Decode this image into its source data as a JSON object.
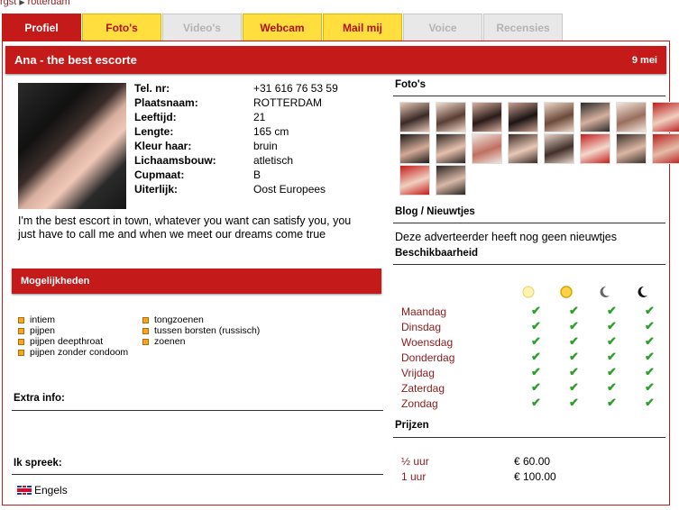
{
  "breadcrumb": {
    "prev": "rgst",
    "current": "rotterdam"
  },
  "tabs": [
    {
      "label": "Profiel",
      "state": "active"
    },
    {
      "label": "Foto's",
      "state": "yellow"
    },
    {
      "label": "Video's",
      "state": "disabled"
    },
    {
      "label": "Webcam",
      "state": "yellow"
    },
    {
      "label": "Mail mij",
      "state": "yellow"
    },
    {
      "label": "Voice",
      "state": "disabled"
    },
    {
      "label": "Recensies",
      "state": "disabled"
    }
  ],
  "title": "Ana - the best escorte",
  "date": "9 mei",
  "profile": {
    "rows": [
      {
        "label": "Tel. nr:",
        "value": "+31 616 76 53 59"
      },
      {
        "label": "Plaatsnaam:",
        "value": "ROTTERDAM"
      },
      {
        "label": "Leeftijd:",
        "value": "21"
      },
      {
        "label": "Lengte:",
        "value": "165 cm"
      },
      {
        "label": "Kleur haar:",
        "value": "bruin"
      },
      {
        "label": "Lichaamsbouw:",
        "value": "atletisch"
      },
      {
        "label": "Cupmaat:",
        "value": "B"
      },
      {
        "label": "Uiterlijk:",
        "value": "Oost Europees"
      }
    ],
    "intro": "I'm the best escort in town, whatever you want can satisfy you, you just have to call me and when we meet our dreams come true"
  },
  "mogelijkheden": {
    "title": "Mogelijkheden",
    "col1": [
      "intiem",
      "pijpen",
      "pijpen deepthroat",
      "pijpen zonder condoom"
    ],
    "col2": [
      "tongzoenen",
      "tussen borsten (russisch)",
      "zoenen"
    ]
  },
  "extra_info": {
    "title": "Extra info:"
  },
  "ik_spreek": {
    "title": "Ik spreek:",
    "language": "Engels"
  },
  "fotos": {
    "title": "Foto's",
    "count": 18
  },
  "blog": {
    "title": "Blog / Nieuwtjes",
    "text": "Deze adverteerder heeft nog geen nieuwtjes"
  },
  "beschikbaarheid": {
    "title": "Beschikbaarheid",
    "days": [
      "Maandag",
      "Dinsdag",
      "Woensdag",
      "Donderdag",
      "Vrijdag",
      "Zaterdag",
      "Zondag"
    ],
    "check": "✔",
    "periods": [
      "morning-icon",
      "afternoon-icon",
      "evening-icon",
      "night-icon"
    ]
  },
  "prijzen": {
    "title": "Prijzen",
    "items": [
      {
        "duration": "½ uur",
        "price": "€ 60.00"
      },
      {
        "duration": "1 uur",
        "price": "€ 100.00"
      }
    ]
  },
  "colors": {
    "accent": "#c41a1a",
    "yellow": "#ffde3d",
    "check": "#2e9e2e",
    "link": "#8b1a1a"
  }
}
